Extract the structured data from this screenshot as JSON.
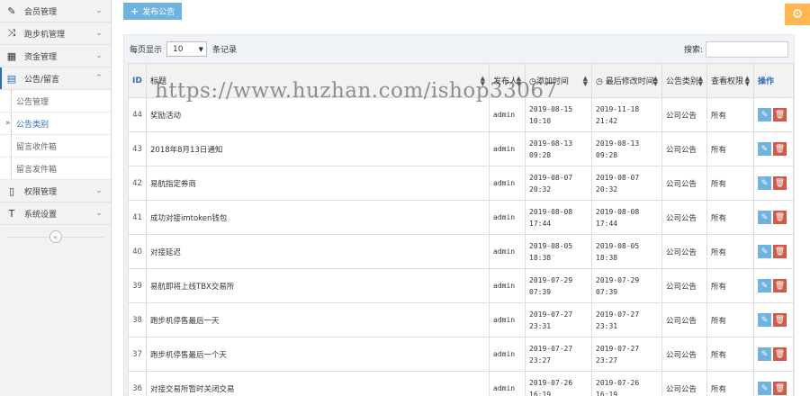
{
  "sidebar": {
    "items": [
      {
        "label": "会员管理",
        "icon": "edit-icon",
        "glyph": "✎"
      },
      {
        "label": "跑步机管理",
        "icon": "shuffle-icon",
        "glyph": "⤨"
      },
      {
        "label": "资金管理",
        "icon": "calendar-icon",
        "glyph": "▦"
      },
      {
        "label": "公告/留言",
        "icon": "list-icon",
        "glyph": "▤"
      },
      {
        "label": "权限管理",
        "icon": "file-icon",
        "glyph": "▯"
      },
      {
        "label": "系统设置",
        "icon": "text-icon",
        "glyph": "T"
      }
    ],
    "sub_items": [
      "公告管理",
      "公告类别",
      "留言收件箱",
      "留言发件箱"
    ],
    "collapse_glyph": "«"
  },
  "toolbar": {
    "publish_label": "发布公告",
    "plus": "+",
    "settings_glyph": "⚙"
  },
  "controls": {
    "per_page_prefix": "每页显示",
    "per_page_value": "10",
    "per_page_suffix": "条记录",
    "search_label": "搜索:",
    "search_value": ""
  },
  "table": {
    "headers": [
      "ID",
      "标题",
      "发布人",
      "◷添加时间",
      "◷ 最后修改时间",
      "公告类别",
      "查看权限",
      "操作"
    ],
    "rows": [
      {
        "id": "44",
        "title": "奖励活动",
        "author": "admin",
        "added": [
          "2019-08-15",
          "10:10"
        ],
        "modified": [
          "2019-11-18",
          "21:42"
        ],
        "category": "公司公告",
        "perm": "所有"
      },
      {
        "id": "43",
        "title": "2018年8月13日通知",
        "author": "admin",
        "added": [
          "2019-08-13",
          "09:28"
        ],
        "modified": [
          "2019-08-13",
          "09:28"
        ],
        "category": "公司公告",
        "perm": "所有"
      },
      {
        "id": "42",
        "title": "易航指定券商",
        "author": "admin",
        "added": [
          "2019-08-07",
          "20:32"
        ],
        "modified": [
          "2019-08-07",
          "20:32"
        ],
        "category": "公司公告",
        "perm": "所有"
      },
      {
        "id": "41",
        "title": "成功对接imtoken钱包",
        "author": "admin",
        "added": [
          "2019-08-08",
          "17:44"
        ],
        "modified": [
          "2019-08-08",
          "17:44"
        ],
        "category": "公司公告",
        "perm": "所有"
      },
      {
        "id": "40",
        "title": "对接延迟",
        "author": "admin",
        "added": [
          "2019-08-05",
          "18:38"
        ],
        "modified": [
          "2019-08-05",
          "18:38"
        ],
        "category": "公司公告",
        "perm": "所有"
      },
      {
        "id": "39",
        "title": "易航即将上线TBX交易所",
        "author": "admin",
        "added": [
          "2019-07-29",
          "07:39"
        ],
        "modified": [
          "2019-07-29",
          "07:39"
        ],
        "category": "公司公告",
        "perm": "所有"
      },
      {
        "id": "38",
        "title": "跑步机停售最后一天",
        "author": "admin",
        "added": [
          "2019-07-27",
          "23:31"
        ],
        "modified": [
          "2019-07-27",
          "23:31"
        ],
        "category": "公司公告",
        "perm": "所有"
      },
      {
        "id": "37",
        "title": "跑步机停售最后一个天",
        "author": "admin",
        "added": [
          "2019-07-27",
          "23:27"
        ],
        "modified": [
          "2019-07-27",
          "23:27"
        ],
        "category": "公司公告",
        "perm": "所有"
      },
      {
        "id": "36",
        "title": "对接交易所暂时关闭交易",
        "author": "admin",
        "added": [
          "2019-07-26",
          "16:19"
        ],
        "modified": [
          "2019-07-26",
          "16:19"
        ],
        "category": "公司公告",
        "perm": "所有"
      }
    ],
    "edit_glyph": "✎",
    "delete_glyph": "🗑"
  },
  "watermark": "https://www.huzhan.com/ishop33067",
  "colors": {
    "accent": "#2a6fb8",
    "edit": "#6fb3e0",
    "delete": "#d15b47",
    "settings": "#ffb752"
  }
}
